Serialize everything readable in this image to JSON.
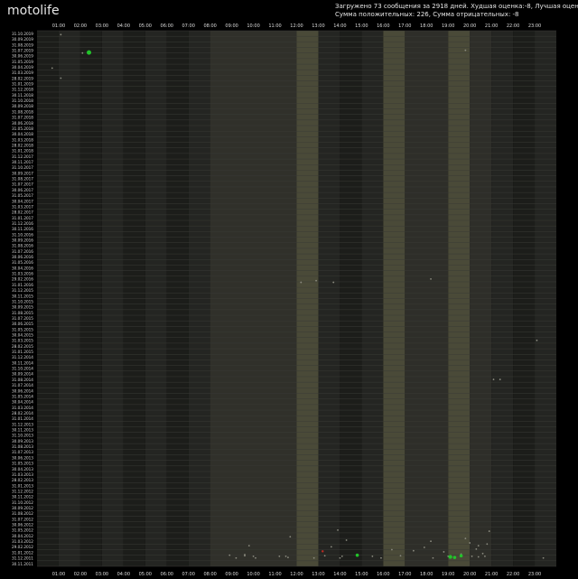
{
  "header": {
    "title": "motolife",
    "stats_line1": "Загружено 73 сообщения за 2918 дней. Худшая оценка:-8, Лучшая оценка:31",
    "stats_line2": "Сумма положительных: 226, Сумма отрицательных: -8"
  },
  "chart_data": {
    "type": "scatter",
    "title": "motolife",
    "hours": [
      "01:00",
      "02:00",
      "03:00",
      "04:00",
      "05:00",
      "06:00",
      "07:00",
      "08:00",
      "09:00",
      "10:00",
      "11:00",
      "12:00",
      "13:00",
      "14:00",
      "15:00",
      "16:00",
      "17:00",
      "18:00",
      "19:00",
      "20:00",
      "21:00",
      "22:00",
      "23:00"
    ],
    "dates": [
      "31.10.2019",
      "30.09.2019",
      "31.08.2019",
      "31.07.2019",
      "30.06.2019",
      "31.05.2019",
      "30.04.2019",
      "31.03.2019",
      "28.02.2019",
      "31.01.2019",
      "31.12.2018",
      "30.11.2018",
      "31.10.2018",
      "30.09.2018",
      "31.08.2018",
      "31.07.2018",
      "30.06.2018",
      "31.05.2018",
      "30.04.2018",
      "31.03.2018",
      "28.02.2018",
      "31.01.2018",
      "31.12.2017",
      "30.11.2017",
      "31.10.2017",
      "30.09.2017",
      "31.08.2017",
      "31.07.2017",
      "30.06.2017",
      "31.05.2017",
      "30.04.2017",
      "31.03.2017",
      "28.02.2017",
      "31.01.2017",
      "31.12.2016",
      "30.11.2016",
      "31.10.2016",
      "30.09.2016",
      "31.08.2016",
      "31.07.2016",
      "30.06.2016",
      "31.05.2016",
      "30.04.2016",
      "31.03.2016",
      "29.02.2016",
      "31.01.2016",
      "31.12.2015",
      "30.11.2015",
      "31.10.2015",
      "30.09.2015",
      "31.08.2015",
      "31.07.2015",
      "30.06.2015",
      "31.05.2015",
      "30.04.2015",
      "31.03.2015",
      "28.02.2015",
      "31.01.2015",
      "31.12.2014",
      "30.11.2014",
      "31.10.2014",
      "30.09.2014",
      "31.08.2014",
      "31.07.2014",
      "30.06.2014",
      "31.05.2014",
      "30.04.2014",
      "31.03.2014",
      "28.02.2014",
      "31.01.2014",
      "31.12.2013",
      "30.11.2013",
      "31.10.2013",
      "30.09.2013",
      "31.08.2013",
      "31.07.2013",
      "30.06.2013",
      "31.05.2013",
      "30.04.2013",
      "31.03.2013",
      "28.02.2013",
      "31.01.2013",
      "31.12.2012",
      "30.11.2012",
      "31.10.2012",
      "30.09.2012",
      "31.08.2012",
      "31.07.2012",
      "30.06.2012",
      "31.05.2012",
      "30.04.2012",
      "31.03.2012",
      "29.02.2012",
      "31.01.2012",
      "31.12.2011",
      "30.11.2011"
    ],
    "shaded_hours": [
      {
        "from": 8,
        "to": 12,
        "color": "#30302a"
      },
      {
        "from": 12,
        "to": 13,
        "color": "#4a4a38"
      },
      {
        "from": 16,
        "to": 17,
        "color": "#4a4a38"
      },
      {
        "from": 19,
        "to": 20,
        "color": "#4a4a38"
      },
      {
        "from": 17,
        "to": 19,
        "color": "#2e2e29"
      },
      {
        "from": 20,
        "to": 21,
        "color": "#2e2e29"
      }
    ],
    "points": [
      {
        "date_index": 0.2,
        "hour": 0.1,
        "score": 0
      },
      {
        "date_index": 3.5,
        "hour": 1.1,
        "score": 0
      },
      {
        "date_index": 3.4,
        "hour": 1.4,
        "score": 4
      },
      {
        "date_index": 3.0,
        "hour": 18.8,
        "score": 0
      },
      {
        "date_index": 6.2,
        "hour": -0.3,
        "score": 0
      },
      {
        "date_index": 8.0,
        "hour": 0.1,
        "score": 0
      },
      {
        "date_index": 44.6,
        "hour": 11.2,
        "score": 0
      },
      {
        "date_index": 44.3,
        "hour": 11.9,
        "score": 0
      },
      {
        "date_index": 44.6,
        "hour": 12.7,
        "score": 0
      },
      {
        "date_index": 44.0,
        "hour": 17.2,
        "score": 0
      },
      {
        "date_index": 55.0,
        "hour": 22.1,
        "score": 0
      },
      {
        "date_index": 62.0,
        "hour": 20.1,
        "score": 0
      },
      {
        "date_index": 62.0,
        "hour": 20.4,
        "score": 0
      },
      {
        "date_index": 89.0,
        "hour": 12.9,
        "score": 0
      },
      {
        "date_index": 89.2,
        "hour": 19.9,
        "score": 0
      },
      {
        "date_index": 90.5,
        "hour": 18.8,
        "score": 0
      },
      {
        "date_index": 90.2,
        "hour": 10.7,
        "score": 0
      },
      {
        "date_index": 91.0,
        "hour": 17.2,
        "score": 0
      },
      {
        "date_index": 91.5,
        "hour": 19.8,
        "score": 0
      },
      {
        "date_index": 91.8,
        "hour": 8.8,
        "score": 0
      },
      {
        "date_index": 92.0,
        "hour": 12.6,
        "score": 0
      },
      {
        "date_index": 92.5,
        "hour": 15.4,
        "score": 0
      },
      {
        "date_index": 92.7,
        "hour": 16.4,
        "score": 0
      },
      {
        "date_index": 92.9,
        "hour": 17.8,
        "score": 0
      },
      {
        "date_index": 93.2,
        "hour": 19.6,
        "score": 0
      },
      {
        "date_index": 93.3,
        "hour": 18.6,
        "score": 0
      },
      {
        "date_index": 93.5,
        "hour": 7.9,
        "score": 0
      },
      {
        "date_index": 93.6,
        "hour": 8.6,
        "score": 0
      },
      {
        "date_index": 93.7,
        "hour": 9.0,
        "score": 0
      },
      {
        "date_index": 93.7,
        "hour": 10.2,
        "score": 0
      },
      {
        "date_index": 93.7,
        "hour": 10.5,
        "score": 0
      },
      {
        "date_index": 93.6,
        "hour": 12.3,
        "score": 0
      },
      {
        "date_index": 93.7,
        "hour": 13.1,
        "score": 0
      },
      {
        "date_index": 93.5,
        "hour": 13.8,
        "score": 2
      },
      {
        "date_index": 93.7,
        "hour": 14.5,
        "score": 0
      },
      {
        "date_index": 93.6,
        "hour": 15.8,
        "score": 0
      },
      {
        "date_index": 93.7,
        "hour": 18.0,
        "score": 0
      },
      {
        "date_index": 93.7,
        "hour": 19.1,
        "score": 0
      },
      {
        "date_index": 93.8,
        "hour": 19.4,
        "score": 0
      },
      {
        "date_index": 93.8,
        "hour": 18.1,
        "score": 3
      },
      {
        "date_index": 93.9,
        "hour": 18.3,
        "score": 2
      },
      {
        "date_index": 93.6,
        "hour": 18.6,
        "score": 2
      },
      {
        "date_index": 93.7,
        "hour": 19.7,
        "score": 0
      },
      {
        "date_index": 94.0,
        "hour": 8.2,
        "score": 0
      },
      {
        "date_index": 94.0,
        "hour": 9.1,
        "score": 0
      },
      {
        "date_index": 94.0,
        "hour": 11.8,
        "score": 0
      },
      {
        "date_index": 94.0,
        "hour": 13.0,
        "score": 0
      },
      {
        "date_index": 94.0,
        "hour": 14.9,
        "score": 0
      },
      {
        "date_index": 94.0,
        "hour": 17.3,
        "score": 0
      },
      {
        "date_index": 94.0,
        "hour": 22.4,
        "score": 0
      },
      {
        "date_index": 92.8,
        "hour": 12.2,
        "score": -1
      },
      {
        "date_index": 92.4,
        "hour": 19.3,
        "score": 0
      },
      {
        "date_index": 92.1,
        "hour": 16.9,
        "score": 0
      },
      {
        "date_index": 91.8,
        "hour": 19.4,
        "score": 0
      },
      {
        "date_index": 91.3,
        "hour": 19.0,
        "score": 0
      },
      {
        "date_index": 90.8,
        "hour": 13.3,
        "score": 0
      },
      {
        "date_index": 93.4,
        "hour": 8.6,
        "score": 0
      },
      {
        "date_index": 93.9,
        "hour": 10.6,
        "score": 0
      }
    ]
  },
  "colors": {
    "background": "#000000",
    "plot_band_a": "#1c1d1a",
    "plot_band_b": "#242522",
    "gridline": "#3a3b36",
    "point_neutral": "#8c8c80",
    "point_positive": "#22c42a",
    "point_negative": "#c02a22"
  }
}
